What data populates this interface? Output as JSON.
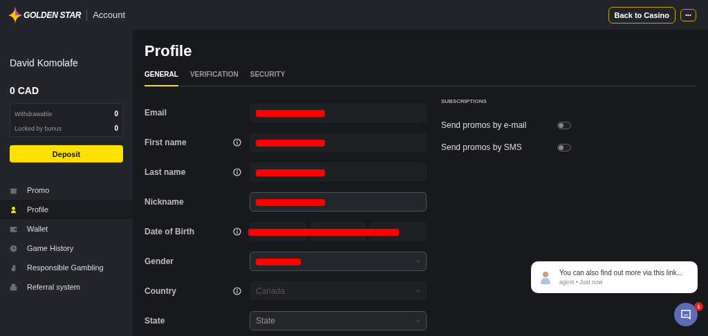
{
  "header": {
    "logo": "GOLDEN STAR",
    "section": "Account",
    "back_button": "Back to Casino",
    "more_button": "•••"
  },
  "sidebar": {
    "user_name": "David Komolafe",
    "balance": "0 CAD",
    "balance_rows": [
      {
        "label": "Withdrawable",
        "value": "0"
      },
      {
        "label": "Locked by bonus",
        "value": "0"
      }
    ],
    "deposit_button": "Deposit",
    "items": [
      {
        "label": "Promo",
        "selected": false
      },
      {
        "label": "Profile",
        "selected": true
      },
      {
        "label": "Wallet",
        "selected": false
      },
      {
        "label": "Game History",
        "selected": false
      },
      {
        "label": "Responsible Gambling",
        "selected": false
      },
      {
        "label": "Referral system",
        "selected": false
      }
    ]
  },
  "page": {
    "title": "Profile",
    "tabs": [
      {
        "label": "GENERAL",
        "selected": true
      },
      {
        "label": "VERIFICATION",
        "selected": false
      },
      {
        "label": "SECURITY",
        "selected": false
      }
    ],
    "fields": [
      {
        "label": "Email",
        "kind": "text",
        "info": false,
        "disabled": true,
        "redacted": true
      },
      {
        "label": "First name",
        "kind": "text",
        "info": true,
        "disabled": true,
        "redacted": true
      },
      {
        "label": "Last name",
        "kind": "text",
        "info": true,
        "disabled": true,
        "redacted": true
      },
      {
        "label": "Nickname",
        "kind": "text",
        "info": false,
        "disabled": false,
        "redacted": true
      },
      {
        "label": "Date of Birth",
        "kind": "date",
        "info": true,
        "disabled": true,
        "redacted": true
      },
      {
        "label": "Gender",
        "kind": "select",
        "info": false,
        "disabled": false,
        "redacted": true
      },
      {
        "label": "Country",
        "kind": "select",
        "info": true,
        "disabled": true,
        "redacted": false,
        "value": "Canada"
      },
      {
        "label": "State",
        "kind": "select",
        "info": false,
        "disabled": false,
        "redacted": false,
        "placeholder": "State"
      }
    ],
    "subscriptions": {
      "heading": "SUBSCRIPTIONS",
      "toggles": [
        {
          "label": "Send promos by e-mail",
          "on": false
        },
        {
          "label": "Send promos by SMS",
          "on": false
        }
      ]
    }
  },
  "chat": {
    "message": "You can also find out more via this link...",
    "meta": "agent • Just now",
    "badge": "1"
  }
}
